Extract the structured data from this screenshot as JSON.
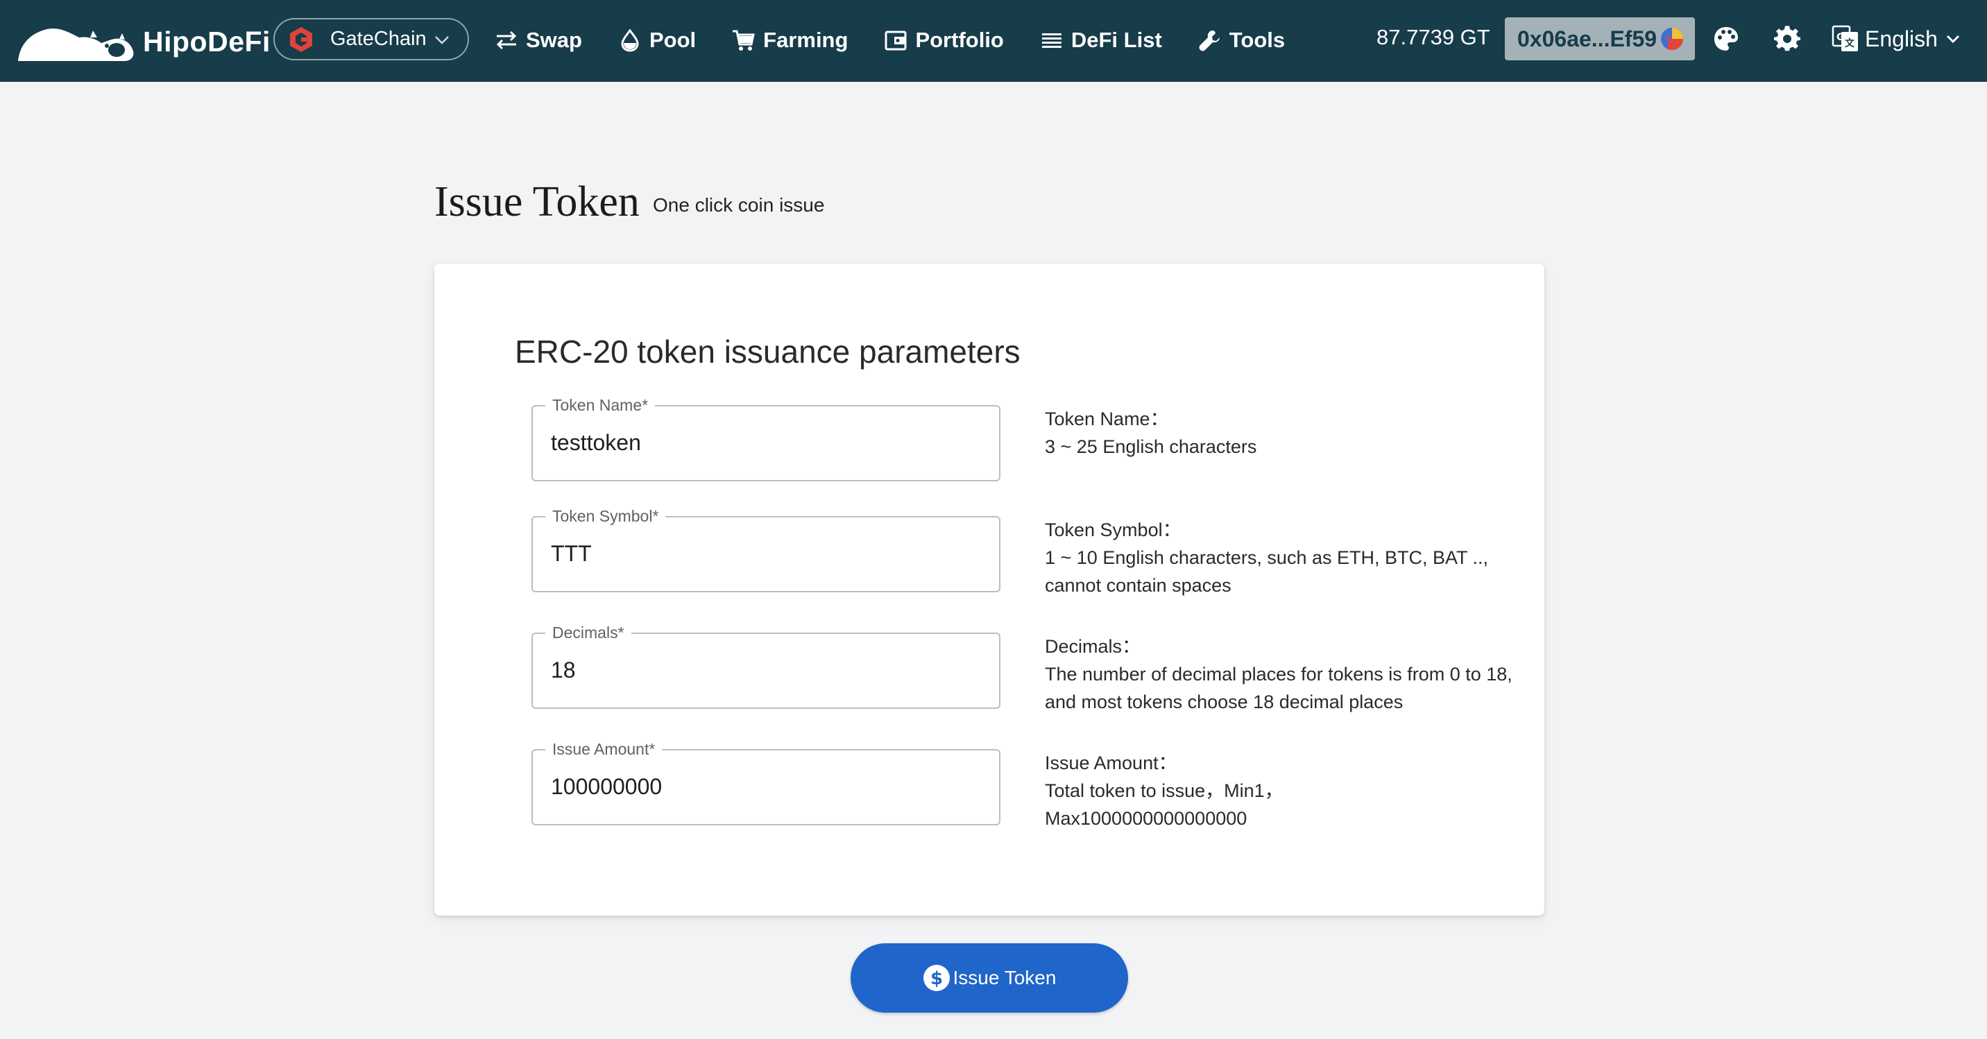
{
  "header": {
    "brand_name": "HipoDeFi",
    "chain": "GateChain",
    "nav": [
      {
        "label": "Swap",
        "icon": "swap-icon"
      },
      {
        "label": "Pool",
        "icon": "drop-icon"
      },
      {
        "label": "Farming",
        "icon": "cart-icon"
      },
      {
        "label": "Portfolio",
        "icon": "wallet-icon"
      },
      {
        "label": "DeFi List",
        "icon": "list-icon"
      },
      {
        "label": "Tools",
        "icon": "wrench-icon"
      }
    ],
    "balance": "87.7739 GT",
    "account": "0x06ae...Ef59",
    "language": "English"
  },
  "page": {
    "title": "Issue Token",
    "subtitle": "One click coin issue"
  },
  "form": {
    "heading": "ERC-20 token issuance parameters",
    "fields": [
      {
        "label": "Token Name*",
        "value": "testtoken",
        "desc_title": "Token Name：",
        "desc_text": "3 ~ 25 English characters"
      },
      {
        "label": "Token Symbol*",
        "value": "TTT",
        "desc_title": "Token Symbol：",
        "desc_text": "1 ~ 10 English characters, such as ETH, BTC, BAT .., cannot contain spaces"
      },
      {
        "label": "Decimals*",
        "value": "18",
        "desc_title": "Decimals：",
        "desc_text": "The number of decimal places for tokens is from 0 to 18, and most tokens choose 18 decimal places"
      },
      {
        "label": "Issue Amount*",
        "value": "100000000",
        "desc_title": "Issue Amount：",
        "desc_text": "Total token to issue，Min1，Max1000000000000000"
      }
    ],
    "submit_label": "Issue Token"
  },
  "colors": {
    "topbar": "#173c4a",
    "accent": "#2065c9",
    "background": "#f2f3f5"
  }
}
